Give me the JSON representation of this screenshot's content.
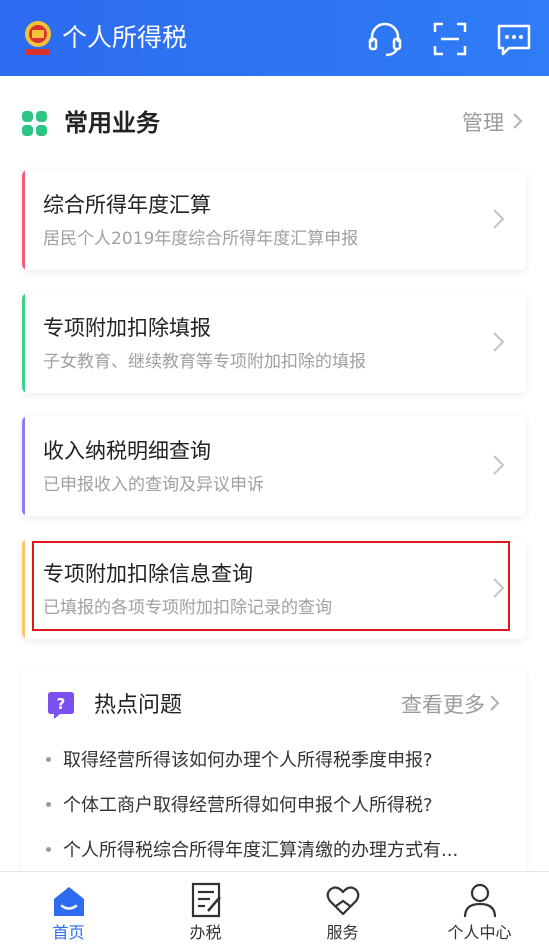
{
  "header": {
    "title": "个人所得税",
    "icons": [
      "customer-service-icon",
      "scan-icon",
      "message-icon"
    ]
  },
  "common": {
    "title": "常用业务",
    "manage_label": "管理",
    "cards": [
      {
        "title": "综合所得年度汇算",
        "subtitle": "居民个人2019年度综合所得年度汇算申报",
        "accent": "#f05b7a"
      },
      {
        "title": "专项附加扣除填报",
        "subtitle": "子女教育、继续教育等专项附加扣除的填报",
        "accent": "#3ecf8e"
      },
      {
        "title": "收入纳税明细查询",
        "subtitle": "已申报收入的查询及异议申诉",
        "accent": "#8e7cf0"
      },
      {
        "title": "专项附加扣除信息查询",
        "subtitle": "已填报的各项专项附加扣除记录的查询",
        "accent": "#f7c66b"
      }
    ]
  },
  "hot": {
    "title": "热点问题",
    "more_label": "查看更多",
    "questions": [
      "取得经营所得该如何办理个人所得税季度申报?",
      "个体工商户取得经营所得如何申报个人所得税?",
      "个人所得税综合所得年度汇算清缴的办理方式有..."
    ]
  },
  "tabbar": {
    "tabs": [
      {
        "label": "首页",
        "icon": "home-icon",
        "active": true
      },
      {
        "label": "办税",
        "icon": "tax-form-icon",
        "active": false
      },
      {
        "label": "服务",
        "icon": "service-heart-icon",
        "active": false
      },
      {
        "label": "个人中心",
        "icon": "user-icon",
        "active": false
      }
    ]
  },
  "colors": {
    "brand_blue": "#2d6bf0",
    "highlight_red": "#e3161d",
    "hot_icon_purple": "#7b4ff0"
  }
}
